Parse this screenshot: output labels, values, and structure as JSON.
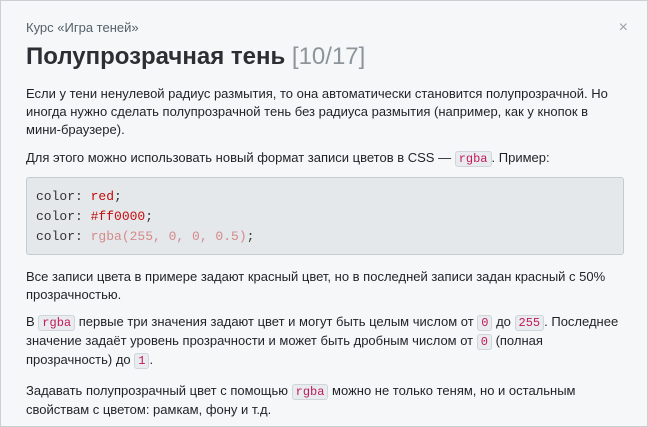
{
  "header": {
    "course_label": "Курс «Игра теней»",
    "title": "Полупрозрачная тень",
    "progress": "[10/17]",
    "close_icon": "×"
  },
  "paragraphs": {
    "p1": "Если у тени ненулевой радиус размытия, то она автоматически становится полупрозрачной. Но иногда нужно сделать полупрозрачной тень без радиуса размытия (например, как у кнопок в мини-браузере).",
    "p2_a": "Для этого можно использовать новый формат записи цветов в CSS — ",
    "p2_code": "rgba",
    "p2_b": ". Пример:",
    "p3": "Все записи цвета в примере задают красный цвет, но в последней записи задан красный с 50% прозрачностью.",
    "p4_a": "В ",
    "p4_code1": "rgba",
    "p4_b": " первые три значения задают цвет и могут быть целым числом от ",
    "p4_code2": "0",
    "p4_c": " до ",
    "p4_code3": "255",
    "p4_d": ". Последнее значение задаёт уровень прозрачности и может быть дробным числом от ",
    "p4_code4": "0",
    "p4_e": " (полная прозрачность) до ",
    "p4_code5": "1",
    "p4_f": ".",
    "p5_a": "Задавать полупрозрачный цвет с помощью ",
    "p5_code": "rgba",
    "p5_b": " можно не только теням, но и остальным свойствам с цветом: рамкам, фону и т.д."
  },
  "code_example": {
    "lines": [
      {
        "prop": "color: ",
        "value": "red",
        "end": ";"
      },
      {
        "prop": "color: ",
        "value": "#ff0000",
        "end": ";"
      },
      {
        "prop": "color: ",
        "value": "rgba(255, 0, 0, 0.5)",
        "end": ";"
      }
    ]
  },
  "colors": {
    "accent_red": "#c40b0b",
    "translucent_red": "#d48a8a",
    "inline_code": "#c2185b"
  }
}
